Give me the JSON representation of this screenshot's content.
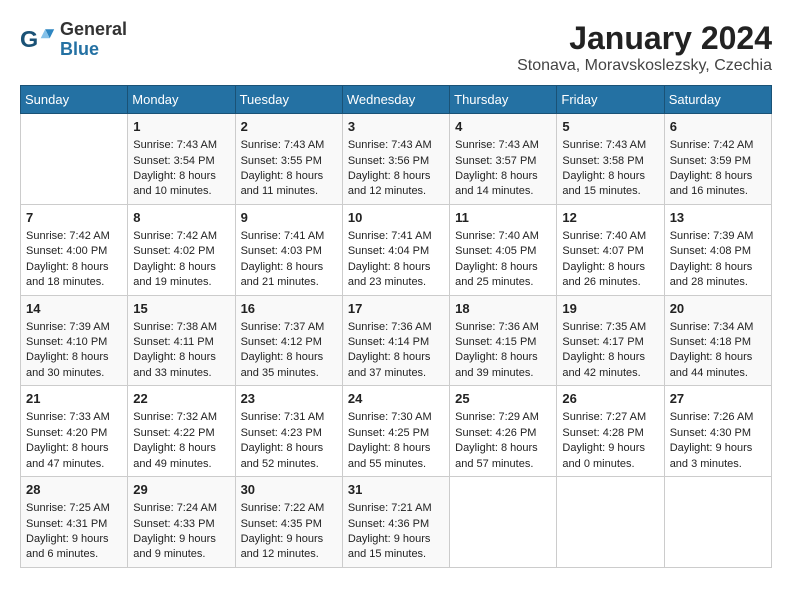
{
  "logo": {
    "line1": "General",
    "line2": "Blue"
  },
  "title": "January 2024",
  "subtitle": "Stonava, Moravskoslezsky, Czechia",
  "days_of_week": [
    "Sunday",
    "Monday",
    "Tuesday",
    "Wednesday",
    "Thursday",
    "Friday",
    "Saturday"
  ],
  "weeks": [
    [
      {
        "day": "",
        "content": ""
      },
      {
        "day": "1",
        "content": "Sunrise: 7:43 AM\nSunset: 3:54 PM\nDaylight: 8 hours\nand 10 minutes."
      },
      {
        "day": "2",
        "content": "Sunrise: 7:43 AM\nSunset: 3:55 PM\nDaylight: 8 hours\nand 11 minutes."
      },
      {
        "day": "3",
        "content": "Sunrise: 7:43 AM\nSunset: 3:56 PM\nDaylight: 8 hours\nand 12 minutes."
      },
      {
        "day": "4",
        "content": "Sunrise: 7:43 AM\nSunset: 3:57 PM\nDaylight: 8 hours\nand 14 minutes."
      },
      {
        "day": "5",
        "content": "Sunrise: 7:43 AM\nSunset: 3:58 PM\nDaylight: 8 hours\nand 15 minutes."
      },
      {
        "day": "6",
        "content": "Sunrise: 7:42 AM\nSunset: 3:59 PM\nDaylight: 8 hours\nand 16 minutes."
      }
    ],
    [
      {
        "day": "7",
        "content": "Sunrise: 7:42 AM\nSunset: 4:00 PM\nDaylight: 8 hours\nand 18 minutes."
      },
      {
        "day": "8",
        "content": "Sunrise: 7:42 AM\nSunset: 4:02 PM\nDaylight: 8 hours\nand 19 minutes."
      },
      {
        "day": "9",
        "content": "Sunrise: 7:41 AM\nSunset: 4:03 PM\nDaylight: 8 hours\nand 21 minutes."
      },
      {
        "day": "10",
        "content": "Sunrise: 7:41 AM\nSunset: 4:04 PM\nDaylight: 8 hours\nand 23 minutes."
      },
      {
        "day": "11",
        "content": "Sunrise: 7:40 AM\nSunset: 4:05 PM\nDaylight: 8 hours\nand 25 minutes."
      },
      {
        "day": "12",
        "content": "Sunrise: 7:40 AM\nSunset: 4:07 PM\nDaylight: 8 hours\nand 26 minutes."
      },
      {
        "day": "13",
        "content": "Sunrise: 7:39 AM\nSunset: 4:08 PM\nDaylight: 8 hours\nand 28 minutes."
      }
    ],
    [
      {
        "day": "14",
        "content": "Sunrise: 7:39 AM\nSunset: 4:10 PM\nDaylight: 8 hours\nand 30 minutes."
      },
      {
        "day": "15",
        "content": "Sunrise: 7:38 AM\nSunset: 4:11 PM\nDaylight: 8 hours\nand 33 minutes."
      },
      {
        "day": "16",
        "content": "Sunrise: 7:37 AM\nSunset: 4:12 PM\nDaylight: 8 hours\nand 35 minutes."
      },
      {
        "day": "17",
        "content": "Sunrise: 7:36 AM\nSunset: 4:14 PM\nDaylight: 8 hours\nand 37 minutes."
      },
      {
        "day": "18",
        "content": "Sunrise: 7:36 AM\nSunset: 4:15 PM\nDaylight: 8 hours\nand 39 minutes."
      },
      {
        "day": "19",
        "content": "Sunrise: 7:35 AM\nSunset: 4:17 PM\nDaylight: 8 hours\nand 42 minutes."
      },
      {
        "day": "20",
        "content": "Sunrise: 7:34 AM\nSunset: 4:18 PM\nDaylight: 8 hours\nand 44 minutes."
      }
    ],
    [
      {
        "day": "21",
        "content": "Sunrise: 7:33 AM\nSunset: 4:20 PM\nDaylight: 8 hours\nand 47 minutes."
      },
      {
        "day": "22",
        "content": "Sunrise: 7:32 AM\nSunset: 4:22 PM\nDaylight: 8 hours\nand 49 minutes."
      },
      {
        "day": "23",
        "content": "Sunrise: 7:31 AM\nSunset: 4:23 PM\nDaylight: 8 hours\nand 52 minutes."
      },
      {
        "day": "24",
        "content": "Sunrise: 7:30 AM\nSunset: 4:25 PM\nDaylight: 8 hours\nand 55 minutes."
      },
      {
        "day": "25",
        "content": "Sunrise: 7:29 AM\nSunset: 4:26 PM\nDaylight: 8 hours\nand 57 minutes."
      },
      {
        "day": "26",
        "content": "Sunrise: 7:27 AM\nSunset: 4:28 PM\nDaylight: 9 hours\nand 0 minutes."
      },
      {
        "day": "27",
        "content": "Sunrise: 7:26 AM\nSunset: 4:30 PM\nDaylight: 9 hours\nand 3 minutes."
      }
    ],
    [
      {
        "day": "28",
        "content": "Sunrise: 7:25 AM\nSunset: 4:31 PM\nDaylight: 9 hours\nand 6 minutes."
      },
      {
        "day": "29",
        "content": "Sunrise: 7:24 AM\nSunset: 4:33 PM\nDaylight: 9 hours\nand 9 minutes."
      },
      {
        "day": "30",
        "content": "Sunrise: 7:22 AM\nSunset: 4:35 PM\nDaylight: 9 hours\nand 12 minutes."
      },
      {
        "day": "31",
        "content": "Sunrise: 7:21 AM\nSunset: 4:36 PM\nDaylight: 9 hours\nand 15 minutes."
      },
      {
        "day": "",
        "content": ""
      },
      {
        "day": "",
        "content": ""
      },
      {
        "day": "",
        "content": ""
      }
    ]
  ]
}
